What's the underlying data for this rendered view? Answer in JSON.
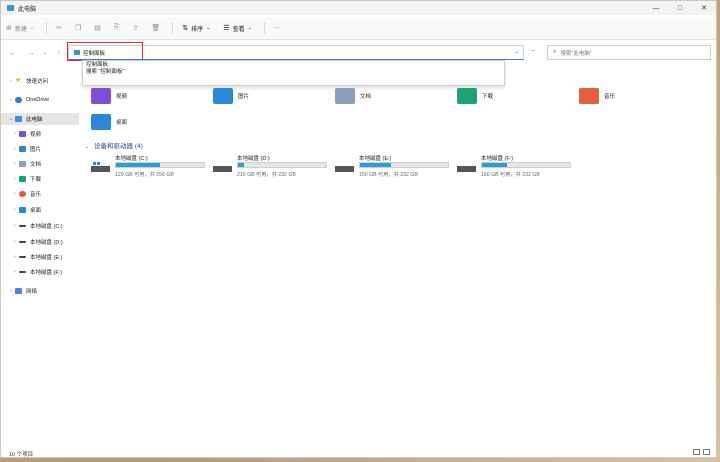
{
  "window": {
    "title": "此电脑"
  },
  "window_controls": {
    "minimize": "—",
    "maximize": "□",
    "close": "✕"
  },
  "toolbar": {
    "new_label": "新建",
    "sort_label": "排序",
    "view_label": "查看",
    "more_label": "···"
  },
  "address": {
    "path": "控制面板"
  },
  "search": {
    "placeholder": "搜索\"此电脑\""
  },
  "suggestions": [
    "控制面板",
    "搜索 \"控制面板\""
  ],
  "sidebar": {
    "items": [
      {
        "label": "快速访问",
        "icon": "star-icon",
        "color": "#f2b400"
      },
      {
        "label": "OneDrive",
        "icon": "cloud-icon",
        "color": "#2a7fd4"
      },
      {
        "label": "此电脑",
        "icon": "computer-icon",
        "color": "#3f8fd6"
      },
      {
        "label": "视频",
        "icon": "video-folder-icon",
        "color": "#7e4fd3"
      },
      {
        "label": "图片",
        "icon": "pictures-folder-icon",
        "color": "#2b88d8"
      },
      {
        "label": "文档",
        "icon": "documents-folder-icon",
        "color": "#8aa0b8"
      },
      {
        "label": "下载",
        "icon": "downloads-folder-icon",
        "color": "#1aa37a"
      },
      {
        "label": "音乐",
        "icon": "music-folder-icon",
        "color": "#e0603c"
      },
      {
        "label": "桌面",
        "icon": "desktop-folder-icon",
        "color": "#2b88d8"
      },
      {
        "label": "本地磁盘 (C:)",
        "icon": "drive-icon",
        "color": "#444444"
      },
      {
        "label": "本地磁盘 (D:)",
        "icon": "drive-icon",
        "color": "#444444"
      },
      {
        "label": "本地磁盘 (E:)",
        "icon": "drive-icon",
        "color": "#444444"
      },
      {
        "label": "本地磁盘 (F:)",
        "icon": "drive-icon",
        "color": "#444444"
      },
      {
        "label": "网络",
        "icon": "network-icon",
        "color": "#3f8fd6"
      }
    ]
  },
  "folders": [
    {
      "label": "视频",
      "color": "#7e4fd3",
      "icon": "video-folder-icon"
    },
    {
      "label": "图片",
      "color": "#2b88d8",
      "icon": "pictures-folder-icon"
    },
    {
      "label": "文档",
      "color": "#8aa0b8",
      "icon": "documents-folder-icon"
    },
    {
      "label": "下载",
      "color": "#1aa37a",
      "icon": "downloads-folder-icon"
    },
    {
      "label": "音乐",
      "color": "#e0603c",
      "icon": "music-folder-icon"
    },
    {
      "label": "桌面",
      "color": "#2b88d8",
      "icon": "desktop-folder-icon"
    }
  ],
  "drives_section": {
    "title": "设备和驱动器 (4)"
  },
  "drives": [
    {
      "name": "本地磁盘 (C:)",
      "free": "129 GB 可用，共 256 GB",
      "used_fraction": 0.5
    },
    {
      "name": "本地磁盘 (D:)",
      "free": "215 GB 可用，共 232 GB",
      "used_fraction": 0.07
    },
    {
      "name": "本地磁盘 (E:)",
      "free": "150 GB 可用，共 232 GB",
      "used_fraction": 0.35
    },
    {
      "name": "本地磁盘 (F:)",
      "free": "166 GB 可用，共 232 GB",
      "used_fraction": 0.28
    }
  ],
  "status": {
    "item_count": "10 个项目"
  }
}
